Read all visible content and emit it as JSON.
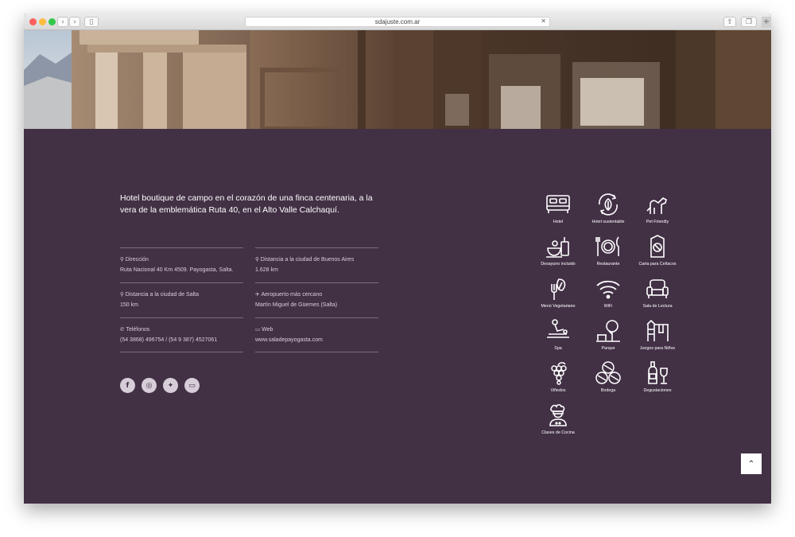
{
  "browser": {
    "url": "sdajuste.com.ar",
    "back_icon": "chevron-left-icon",
    "forward_icon": "chevron-right-icon"
  },
  "footer": {
    "tagline": "Hotel boutique de campo en el corazón de una finca centenaria, a la vera de la emblemática Ruta 40, en el Alto Valle Calchaquí.",
    "info": [
      {
        "label": "Dirección",
        "value": "Ruta Nacional 40 Km 4509. Payogasta, Salta.",
        "icon": "map-marker-icon"
      },
      {
        "label": "Distancia a la ciudad de Buenos Aires",
        "value": "1.628 km",
        "icon": "map-marker-icon"
      },
      {
        "label": "Distancia a la ciudad de Salta",
        "value": "150 km",
        "icon": "map-marker-icon"
      },
      {
        "label": "Aeropuerto más cercano",
        "value": "Martín Miguel de Güemes (Salta)",
        "icon": "plane-icon"
      },
      {
        "label": "Teléfonos",
        "value": "(54 3868) 496754 / (54 9 387) 4527061",
        "icon": "phone-icon"
      },
      {
        "label": "Web",
        "value": "www.saladepayogasta.com",
        "icon": "monitor-icon"
      }
    ],
    "socials": [
      {
        "name": "facebook",
        "glyph": "f"
      },
      {
        "name": "instagram",
        "glyph": "◎"
      },
      {
        "name": "twitter",
        "glyph": "✦"
      },
      {
        "name": "website",
        "glyph": "▭"
      }
    ],
    "amenities": [
      {
        "label": "Hotel",
        "icon": "bed-icon"
      },
      {
        "label": "Hotel sustentable",
        "icon": "leaf-cycle-icon"
      },
      {
        "label": "Pet Friendly",
        "icon": "dog-icon"
      },
      {
        "label": "Desayuno incluido",
        "icon": "breakfast-icon"
      },
      {
        "label": "Restaurante",
        "icon": "plate-cutlery-icon"
      },
      {
        "label": "Carta para Celíacos",
        "icon": "menu-card-icon"
      },
      {
        "label": "Menú Vegetariano",
        "icon": "vegetarian-fork-icon"
      },
      {
        "label": "WiFi",
        "icon": "wifi-icon"
      },
      {
        "label": "Sala de Lectura",
        "icon": "armchair-icon"
      },
      {
        "label": "Spa",
        "icon": "massage-icon"
      },
      {
        "label": "Parque",
        "icon": "park-icon"
      },
      {
        "label": "Juegos para Niños",
        "icon": "playground-icon"
      },
      {
        "label": "Viñedos",
        "icon": "grapes-icon"
      },
      {
        "label": "Bodega",
        "icon": "barrels-icon"
      },
      {
        "label": "Degustaciones",
        "icon": "wine-bottle-icon"
      },
      {
        "label": "Clases de Cocina",
        "icon": "chef-icon"
      }
    ]
  },
  "colors": {
    "footer_bg": "#423045",
    "text_muted": "#d9cfdb",
    "divider": "#7d6c80"
  },
  "scroll_top": {
    "icon": "chevron-up-icon",
    "glyph": "⌃"
  }
}
